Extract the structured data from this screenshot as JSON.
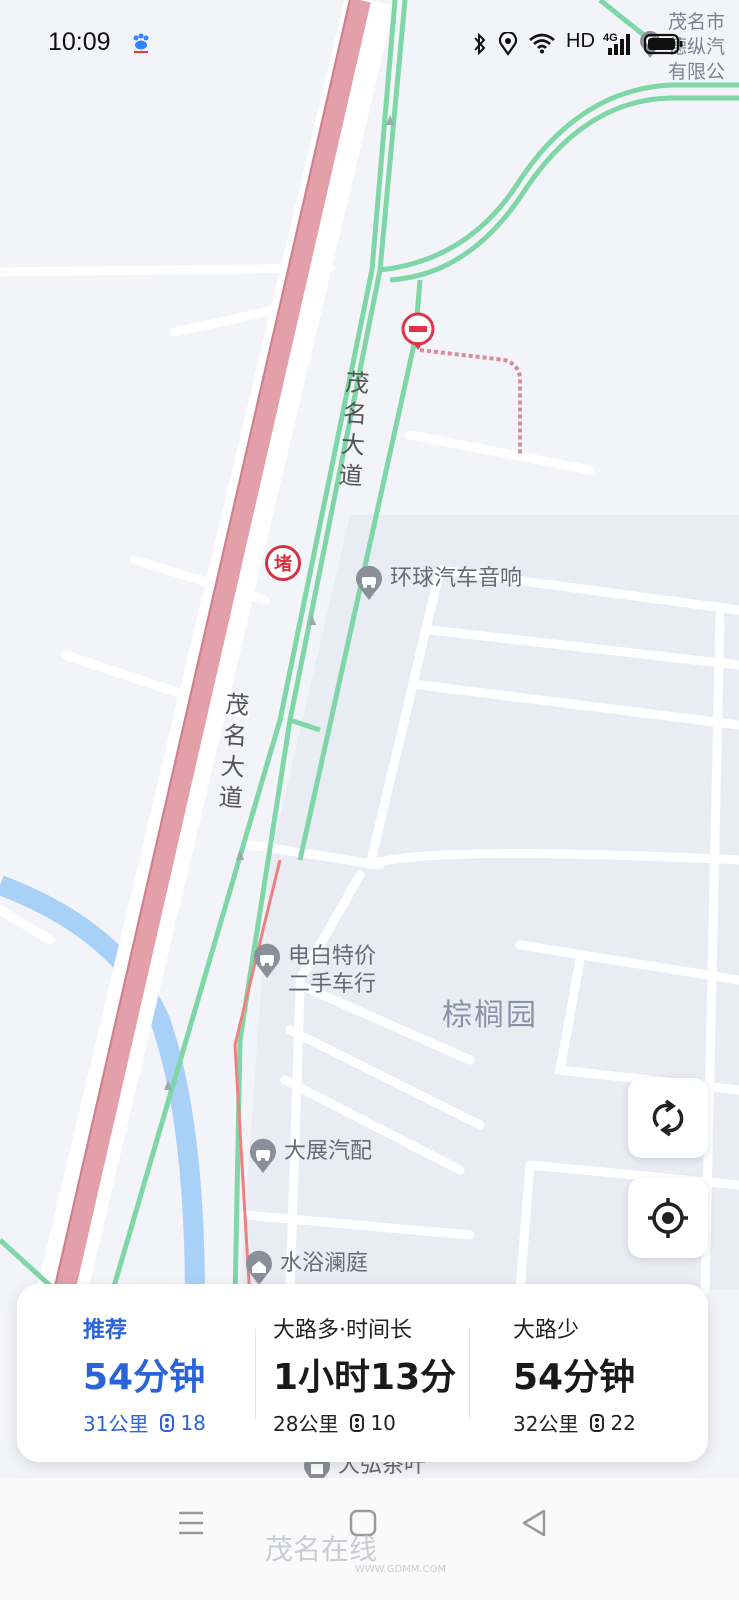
{
  "status_bar": {
    "time": "10:09",
    "network": "HD",
    "signal_label": "4G",
    "icons": [
      "baidu-paw-icon",
      "bluetooth-icon",
      "location-icon",
      "wifi-icon",
      "signal-icon",
      "battery-icon"
    ]
  },
  "map": {
    "road_labels": [
      "茂\n名\n大\n道",
      "茂\n名\n大\n道"
    ],
    "congestion_badge": "堵",
    "area_label": "棕榈园",
    "corner_poi": "茂名市\n德纵汽\n有限公",
    "pois": [
      {
        "name": "环球汽车音响",
        "icon": "car-pin-icon"
      },
      {
        "name": "电白特价\n二手车行",
        "icon": "car-pin-icon"
      },
      {
        "name": "大展汽配",
        "icon": "car-pin-icon"
      },
      {
        "name": "水浴澜庭",
        "icon": "house-pin-icon"
      },
      {
        "name": "大弘茶叶",
        "icon": "shop-pin-icon"
      }
    ],
    "colors": {
      "background": "#f3f4f9",
      "congested_road": "#d98b96",
      "main_road": "#ffffff",
      "route_green": "#7fd6a6",
      "river": "#a9d1f7",
      "block": "#e9ecf3",
      "accent_blue": "#2b64d8"
    }
  },
  "controls": {
    "refresh_icon": "refresh-icon",
    "locate_icon": "locate-icon"
  },
  "routes": [
    {
      "tag": "推荐",
      "duration": "54分钟",
      "distance": "31公里",
      "lights": "18",
      "selected": true
    },
    {
      "tag": "大路多·时间长",
      "duration": "1小时13分",
      "distance": "28公里",
      "lights": "10",
      "selected": false
    },
    {
      "tag": "大路少",
      "duration": "54分钟",
      "distance": "32公里",
      "lights": "22",
      "selected": false
    }
  ],
  "nav_bar": {
    "icons": [
      "menu-icon",
      "home-icon",
      "back-icon"
    ],
    "watermark": "茂名在线",
    "watermark_url": "WWW.GDMM.COM"
  }
}
